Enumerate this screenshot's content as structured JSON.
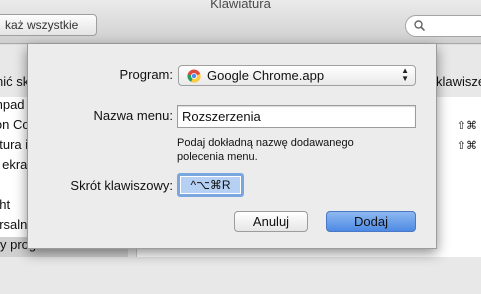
{
  "window": {
    "title": "Klawiatura",
    "show_all_label": "każ wszystkie"
  },
  "background": {
    "hint_left": "nić skrót, kliknij",
    "hint_right": "klawisze.",
    "sidebar_items": [
      {
        "label": "thpad i Dock"
      },
      {
        "label": "ion Control"
      },
      {
        "label": "atura i tekst"
      },
      {
        "label": "y ekranu"
      },
      {
        "label": "i"
      },
      {
        "label": "ght"
      },
      {
        "label": "ersalny dostęp"
      },
      {
        "label": "y programów"
      }
    ],
    "shortcuts_right": [
      "⇧⌘",
      "⇧⌘"
    ]
  },
  "sheet": {
    "program_label": "Program:",
    "program_value": "Google Chrome.app",
    "menu_name_label": "Nazwa menu:",
    "menu_name_value": "Rozszerzenia",
    "help_text_line1": "Podaj dokładną nazwę dodawanego",
    "help_text_line2": "polecenia menu.",
    "shortcut_label": "Skrót klawiszowy:",
    "shortcut_value": "^⌥⌘R",
    "cancel_label": "Anuluj",
    "add_label": "Dodaj"
  }
}
